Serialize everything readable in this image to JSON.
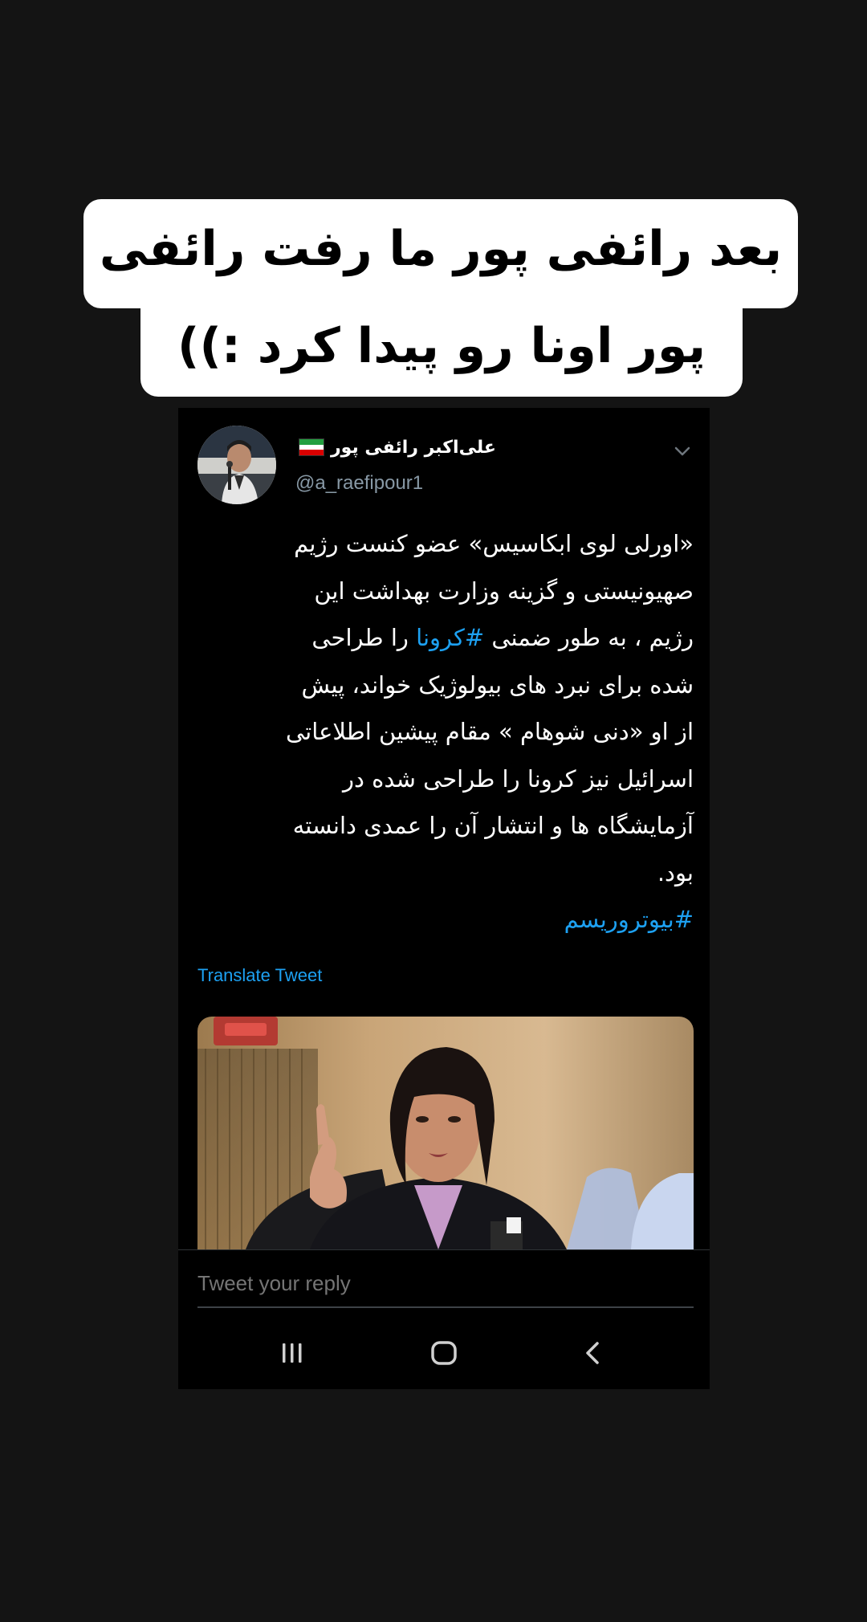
{
  "caption": {
    "line1": "بعد رائفی پور ما رفت رائفی",
    "line2": "پور اونا رو پیدا کرد :))"
  },
  "tweet": {
    "display_name": "علی‌اکبر رائفی پور",
    "handle": "@a_raefipour1",
    "body_lines": [
      "«اورلی لوی ابکاسیس» عضو کنست رژیم",
      "صهیونیستی و گزینه وزارت بهداشت این",
      "رژیم ، به طور ضمنی",
      "شده برای نبرد های بیولوژیک خواند، پیش",
      "از او «دنی شوهام » مقام پیشین اطلاعاتی",
      "اسرائیل نیز کرونا را طراحی شده در",
      "آزمایشگاه ها و انتشار آن را عمدی دانسته",
      "بود."
    ],
    "inline_hashtag": "#کرونا",
    "line3_suffix": "را طراحی",
    "final_hashtag": "#بیوتروریسم",
    "translate_label": "Translate Tweet"
  },
  "reply": {
    "placeholder": "Tweet your reply"
  },
  "icons": {
    "menu_chevron": "chevron-down-icon",
    "recent_apps": "recent-apps-icon",
    "home": "home-icon",
    "back": "back-icon"
  },
  "colors": {
    "background": "#141414",
    "tweet_bg": "#000000",
    "link": "#1da1f2",
    "handle": "#8899a6"
  }
}
